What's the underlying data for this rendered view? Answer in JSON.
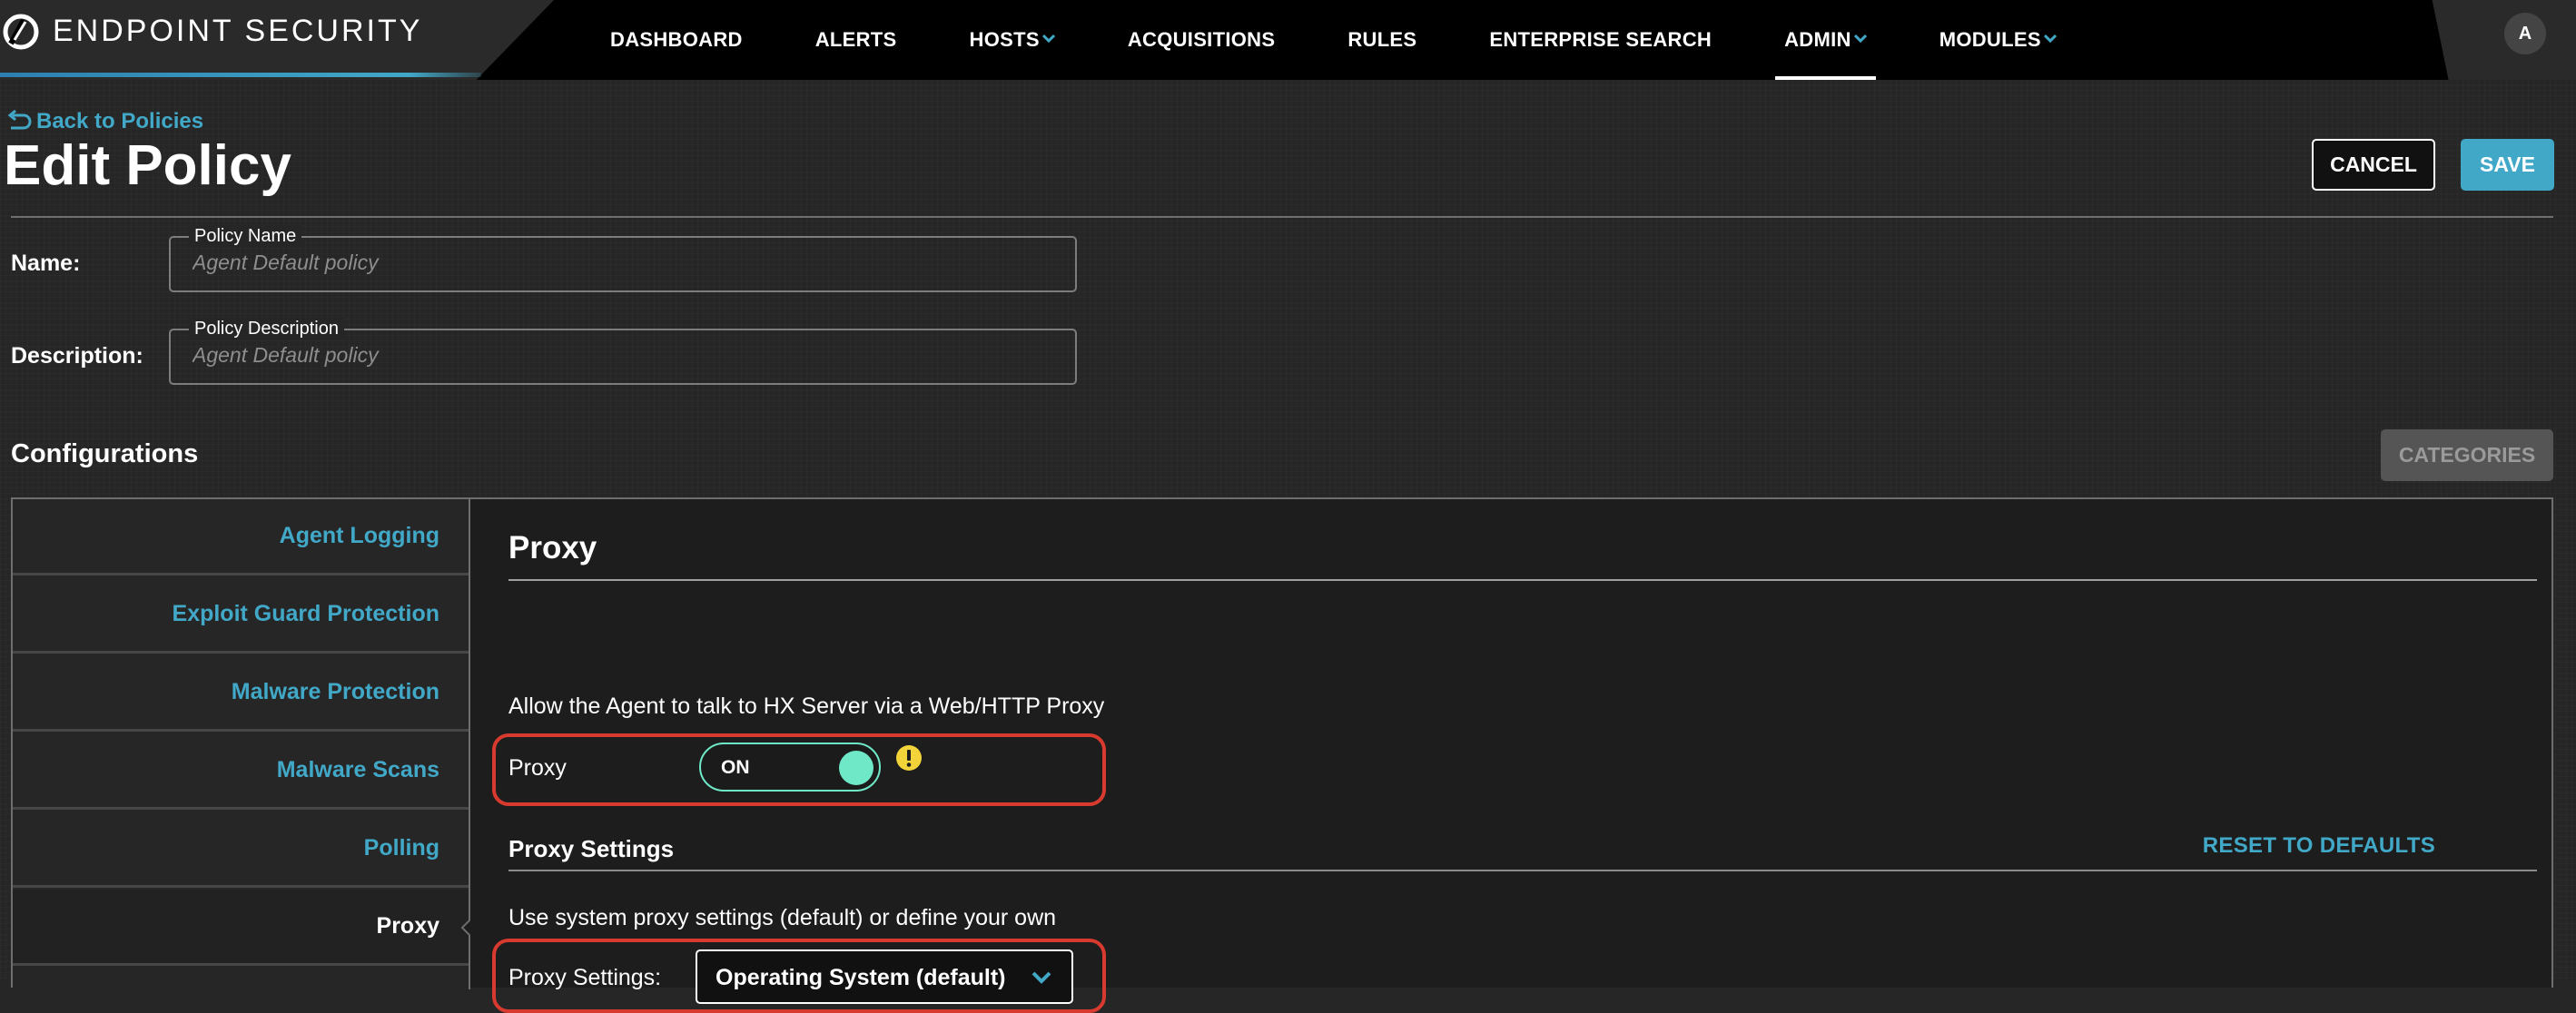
{
  "app": {
    "brand": "ENDPOINT SECURITY",
    "avatar_initial": "A"
  },
  "nav": {
    "items": [
      {
        "label": "DASHBOARD",
        "has_dropdown": false,
        "active": false
      },
      {
        "label": "ALERTS",
        "has_dropdown": false,
        "active": false
      },
      {
        "label": "HOSTS",
        "has_dropdown": true,
        "active": false
      },
      {
        "label": "ACQUISITIONS",
        "has_dropdown": false,
        "active": false
      },
      {
        "label": "RULES",
        "has_dropdown": false,
        "active": false
      },
      {
        "label": "ENTERPRISE SEARCH",
        "has_dropdown": false,
        "active": false
      },
      {
        "label": "ADMIN",
        "has_dropdown": true,
        "active": true
      },
      {
        "label": "MODULES",
        "has_dropdown": true,
        "active": false
      }
    ]
  },
  "header": {
    "back_label": "Back to Policies",
    "title": "Edit Policy",
    "cancel_label": "CANCEL",
    "save_label": "SAVE"
  },
  "form": {
    "name": {
      "label": "Name:",
      "legend": "Policy Name",
      "placeholder": "Agent Default policy"
    },
    "description": {
      "label": "Description:",
      "legend": "Policy Description",
      "placeholder": "Agent Default policy"
    }
  },
  "configurations": {
    "title": "Configurations",
    "categories_label": "CATEGORIES",
    "sidebar": {
      "items": [
        {
          "label": "Agent Logging",
          "active": false
        },
        {
          "label": "Exploit Guard Protection",
          "active": false
        },
        {
          "label": "Malware Protection",
          "active": false
        },
        {
          "label": "Malware Scans",
          "active": false
        },
        {
          "label": "Polling",
          "active": false
        },
        {
          "label": "Proxy",
          "active": true
        }
      ]
    },
    "section": {
      "title": "Proxy",
      "description": "Allow the Agent to talk to HX Server via a Web/HTTP Proxy",
      "proxy_label": "Proxy",
      "proxy_toggle_state": "ON",
      "settings_title": "Proxy Settings",
      "reset_label": "RESET TO DEFAULTS",
      "settings_description": "Use system proxy settings (default) or define your own",
      "settings_label": "Proxy Settings:",
      "settings_value": "Operating System (default)"
    }
  },
  "colors": {
    "accent": "#41a8c8",
    "toggle_on": "#6fe8c8",
    "highlight": "#d83a2f",
    "warning": "#f2d43a"
  }
}
